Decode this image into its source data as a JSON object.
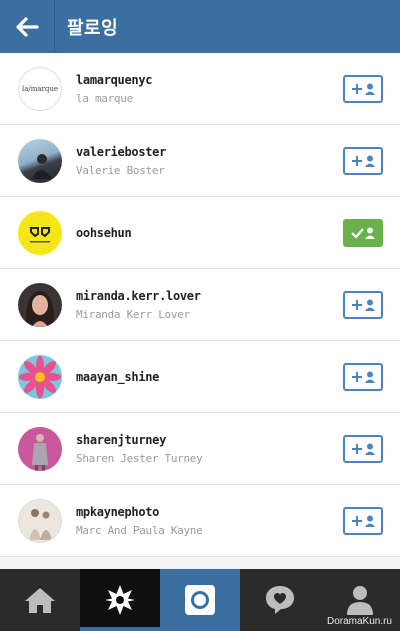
{
  "header": {
    "title": "팔로잉"
  },
  "users": [
    {
      "username": "lamarquenyc",
      "fullname": "la marque",
      "following": false,
      "avatar_text": "la/marque"
    },
    {
      "username": "valerieboster",
      "fullname": "Valerie Boster",
      "following": false
    },
    {
      "username": "oohsehun",
      "fullname": "",
      "following": true
    },
    {
      "username": "miranda.kerr.lover",
      "fullname": "Miranda Kerr Lover",
      "following": false
    },
    {
      "username": "maayan_shine",
      "fullname": "",
      "following": false
    },
    {
      "username": "sharenjturney",
      "fullname": "Sharen Jester Turney",
      "following": false
    },
    {
      "username": "mpkaynephoto",
      "fullname": "Marc And Paula Kayne",
      "following": false
    }
  ],
  "tabbar": {
    "tabs": [
      "home",
      "explore",
      "camera",
      "activity",
      "profile"
    ]
  },
  "watermark": "DoramaKun.ru",
  "colors": {
    "accent": "#3c6fa1",
    "following": "#6ab04c",
    "tabbar": "#2b2b2b"
  }
}
